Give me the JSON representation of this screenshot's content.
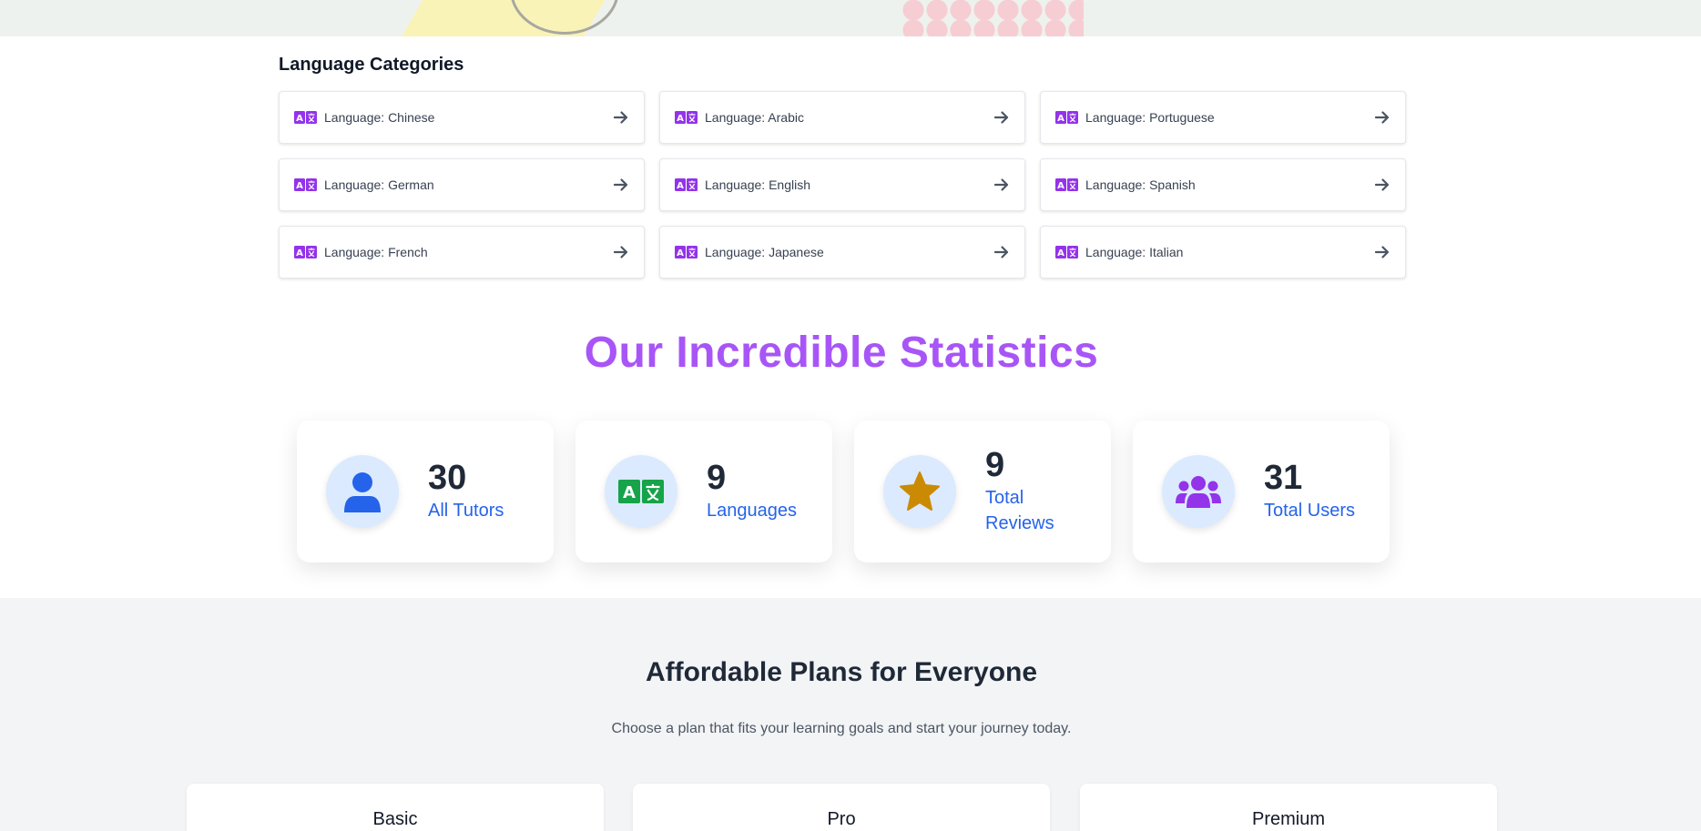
{
  "language_categories": {
    "title": "Language Categories",
    "items": [
      {
        "label": "Language: Chinese"
      },
      {
        "label": "Language: Arabic"
      },
      {
        "label": "Language: Portuguese"
      },
      {
        "label": "Language: German"
      },
      {
        "label": "Language: English"
      },
      {
        "label": "Language: Spanish"
      },
      {
        "label": "Language: French"
      },
      {
        "label": "Language: Japanese"
      },
      {
        "label": "Language: Italian"
      }
    ],
    "item_icon": "language-icon",
    "arrow_icon": "arrow-right-icon"
  },
  "statistics": {
    "title": "Our Incredible Statistics",
    "cards": [
      {
        "value": "30",
        "label": "All Tutors",
        "icon": "user-icon"
      },
      {
        "value": "9",
        "label": "Languages",
        "icon": "language-icon"
      },
      {
        "value": "9",
        "label": "Total Reviews",
        "icon": "star-icon"
      },
      {
        "value": "31",
        "label": "Total Users",
        "icon": "users-icon"
      }
    ]
  },
  "pricing": {
    "title": "Affordable Plans for Everyone",
    "subtitle": "Choose a plan that fits your learning goals and start your journey today.",
    "plans": [
      {
        "name": "Basic"
      },
      {
        "name": "Pro"
      },
      {
        "name": "Premium"
      }
    ]
  },
  "colors": {
    "accent_purple": "#a855f7",
    "icon_purple": "#9333ea",
    "stat_blue": "#2563eb",
    "stat_circle_bg": "#dbeafe",
    "star_gold": "#ca8a04",
    "translate_green": "#16a34a"
  }
}
